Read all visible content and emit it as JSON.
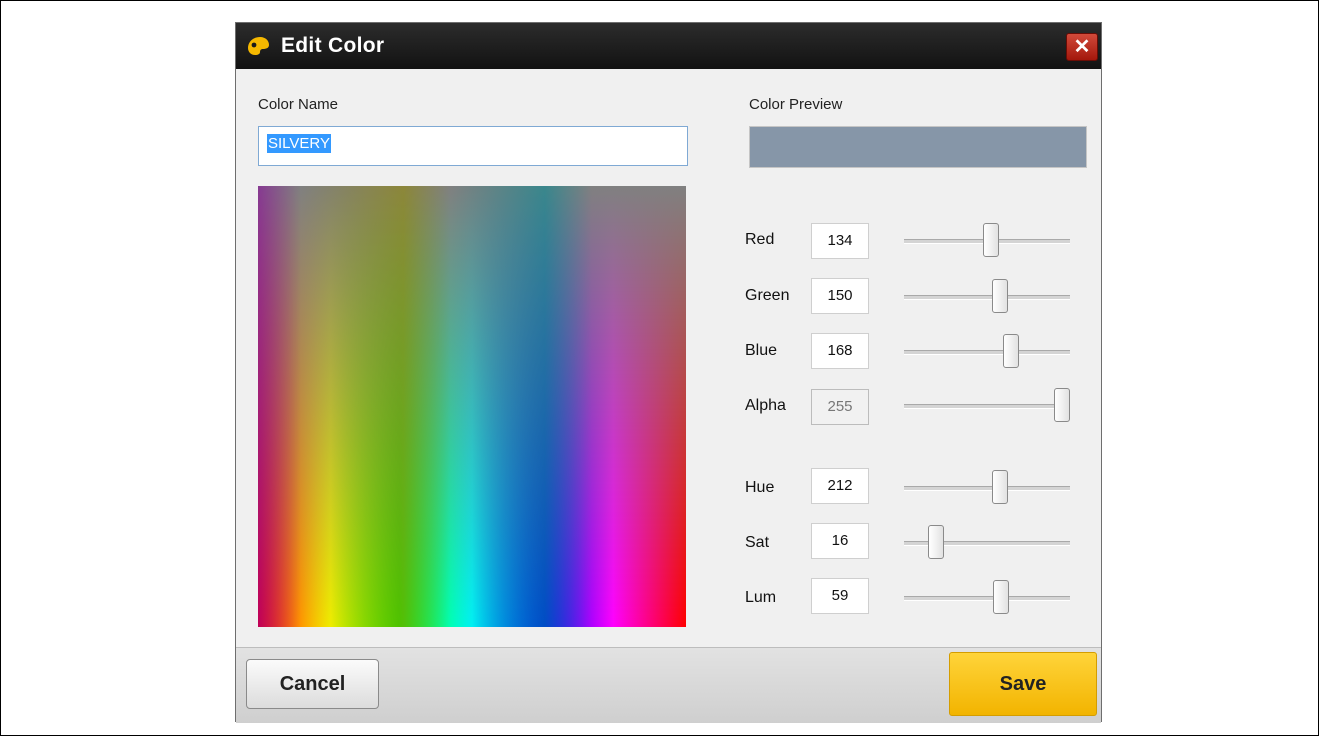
{
  "dialog": {
    "title": "Edit Color",
    "close_icon": "close-icon",
    "title_icon": "palette-icon"
  },
  "color_name": {
    "label": "Color Name",
    "value": "SILVERY"
  },
  "preview": {
    "label": "Color Preview",
    "color": "#8696a8"
  },
  "rgb_fields": [
    {
      "label": "Red",
      "value": "134",
      "max": 255
    },
    {
      "label": "Green",
      "value": "150",
      "max": 255
    },
    {
      "label": "Blue",
      "value": "168",
      "max": 255
    },
    {
      "label": "Alpha",
      "value": "255",
      "max": 255,
      "disabled": true
    }
  ],
  "hsl_fields": [
    {
      "label": "Hue",
      "value": "212",
      "max": 360
    },
    {
      "label": "Sat",
      "value": "16",
      "max": 100
    },
    {
      "label": "Lum",
      "value": "59",
      "max": 100
    }
  ],
  "buttons": {
    "cancel": "Cancel",
    "save": "Save",
    "save_color": "#f9c51a"
  }
}
